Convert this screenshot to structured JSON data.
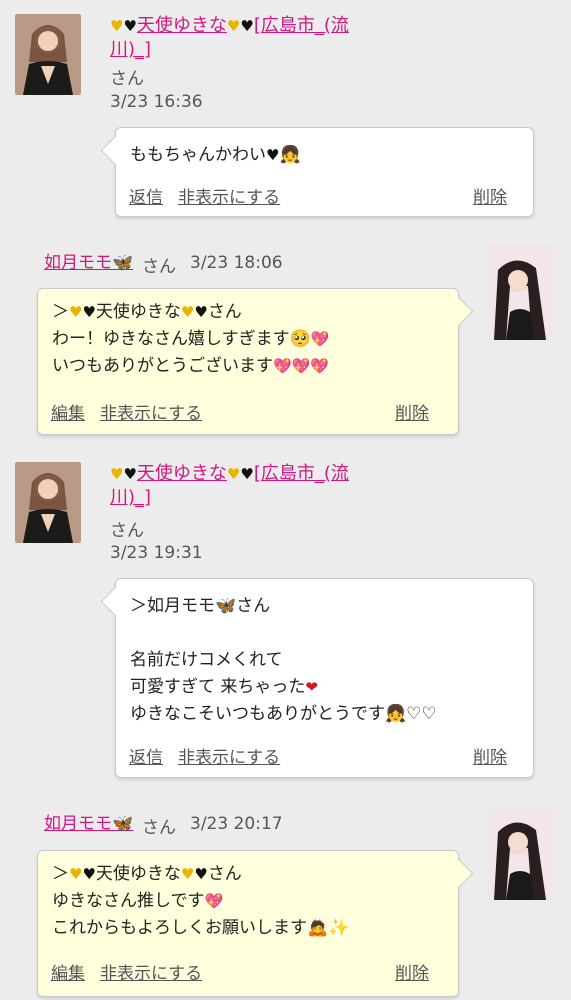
{
  "comments": [
    {
      "author": {
        "name_line1": "天使ゆきな",
        "name_line1_suffix": "[広島市_(流",
        "name_line2": "川)_]",
        "san": "さん"
      },
      "time": "3/23 16:36",
      "message": {
        "text": "ももちゃんかわい",
        "icons": [
          "black-heart-icon",
          "blonde-girl-icon"
        ]
      },
      "actions": {
        "reply": "返信",
        "hide": "非表示にする",
        "delete": "削除"
      }
    },
    {
      "author": {
        "name": "如月モモ",
        "icon": "butterfly-icon",
        "san": "さん"
      },
      "time": "3/23 18:06",
      "message": {
        "line1_prefix": "＞",
        "line1_name": "天使ゆきな",
        "line1_suffix": "さん",
        "line2": "わー！ゆきなさん嬉しすぎます",
        "line3": "いつもありがとうございます"
      },
      "actions": {
        "edit": "編集",
        "hide": "非表示にする",
        "delete": "削除"
      }
    },
    {
      "author": {
        "name_line1": "天使ゆきな",
        "name_line1_suffix": "[広島市_(流",
        "name_line2": "川)_]",
        "san": "さん"
      },
      "time": "3/23 19:31",
      "message": {
        "line1_prefix": "＞如月モモ",
        "line1_suffix": "さん",
        "line2": "名前だけコメくれて",
        "line3": "可愛すぎて 来ちゃった",
        "line4": "ゆきなこそいつもありがとうです"
      },
      "actions": {
        "reply": "返信",
        "hide": "非表示にする",
        "delete": "削除"
      }
    },
    {
      "author": {
        "name": "如月モモ",
        "icon": "butterfly-icon",
        "san": "さん"
      },
      "time": "3/23 20:17",
      "message": {
        "line1_prefix": "＞",
        "line1_name": "天使ゆきな",
        "line1_suffix": "さん",
        "line2": "ゆきなさん推しです",
        "line3": "これからもよろしくお願いします"
      },
      "actions": {
        "edit": "編集",
        "hide": "非表示にする",
        "delete": "削除"
      }
    }
  ],
  "colors": {
    "name_link": "#d4167f",
    "white_bubble": "#ffffff",
    "yellow_bubble": "#ffffdd",
    "background": "#ececec"
  }
}
